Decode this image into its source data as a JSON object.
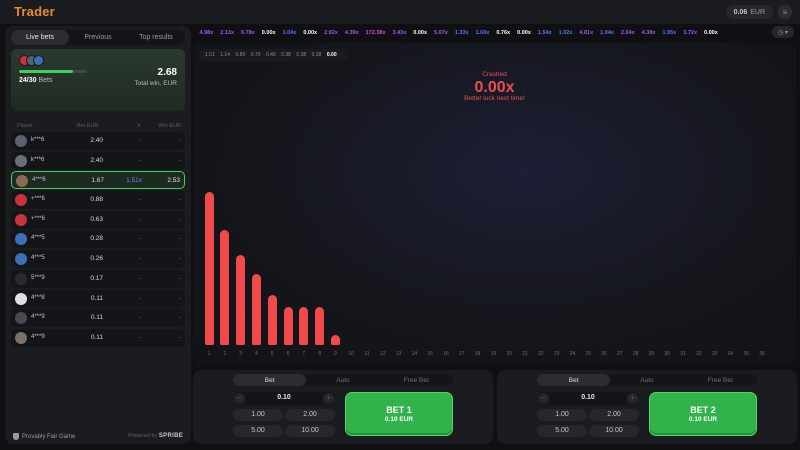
{
  "app": {
    "title": "Trader"
  },
  "header": {
    "balance_value": "0.06",
    "balance_currency": "EUR",
    "menu_icon": "hamburger-icon"
  },
  "left_panel": {
    "tabs": [
      "Live bets",
      "Previous",
      "Top results"
    ],
    "active_tab": 0,
    "summary": {
      "bets_count": "24/30",
      "bets_label": "Bets",
      "total_win": "2.68",
      "total_win_label": "Total win, EUR",
      "progress": 0.8
    },
    "columns": {
      "player": "Player",
      "bet": "Bet EUR",
      "x": "X",
      "win": "Win EUR"
    },
    "players": [
      {
        "name": "k***6",
        "bet": "2.40",
        "x": "-",
        "win": "-",
        "avatar_color": "#5a6270",
        "highlighted": false
      },
      {
        "name": "k***6",
        "bet": "2.40",
        "x": "-",
        "win": "-",
        "avatar_color": "#6b6f78",
        "highlighted": false
      },
      {
        "name": "4***6",
        "bet": "1.67",
        "x": "1.51x",
        "win": "2.53",
        "avatar_color": "#8a6a55",
        "highlighted": true
      },
      {
        "name": "+***6",
        "bet": "0.88",
        "x": "-",
        "win": "-",
        "avatar_color": "#c8323c",
        "highlighted": false
      },
      {
        "name": "+***6",
        "bet": "0.63",
        "x": "-",
        "win": "-",
        "avatar_color": "#c8323c",
        "highlighted": false
      },
      {
        "name": "4***5",
        "bet": "0.28",
        "x": "-",
        "win": "-",
        "avatar_color": "#3b6fb6",
        "highlighted": false
      },
      {
        "name": "4***5",
        "bet": "0.26",
        "x": "-",
        "win": "-",
        "avatar_color": "#3b6fb6",
        "highlighted": false
      },
      {
        "name": "5***9",
        "bet": "0.17",
        "x": "-",
        "win": "-",
        "avatar_color": "#2a2b30",
        "highlighted": false
      },
      {
        "name": "4***8",
        "bet": "0.11",
        "x": "-",
        "win": "-",
        "avatar_color": "#e0e0e4",
        "highlighted": false
      },
      {
        "name": "4***9",
        "bet": "0.11",
        "x": "-",
        "win": "-",
        "avatar_color": "#4a4b52",
        "highlighted": false
      },
      {
        "name": "4***9",
        "bet": "0.11",
        "x": "-",
        "win": "-",
        "avatar_color": "#7a7066",
        "highlighted": false
      }
    ],
    "footer": {
      "provably_fair": "Provably Fair Game",
      "powered_by": "Powered by",
      "brand": "SPRIBE"
    }
  },
  "history": [
    {
      "v": "4.98x",
      "c": "#a855f7"
    },
    {
      "v": "2.13x",
      "c": "#a855f7"
    },
    {
      "v": "6.78x",
      "c": "#a855f7"
    },
    {
      "v": "0.00x",
      "c": "#ffffff"
    },
    {
      "v": "1.04x",
      "c": "#4f7cff"
    },
    {
      "v": "0.00x",
      "c": "#ffffff"
    },
    {
      "v": "2.92x",
      "c": "#a855f7"
    },
    {
      "v": "4.39x",
      "c": "#a855f7"
    },
    {
      "v": "172.38x",
      "c": "#d946ef"
    },
    {
      "v": "3.43x",
      "c": "#a855f7"
    },
    {
      "v": "0.00x",
      "c": "#ffffff"
    },
    {
      "v": "5.07x",
      "c": "#a855f7"
    },
    {
      "v": "1.33x",
      "c": "#4f7cff"
    },
    {
      "v": "1.60x",
      "c": "#4f7cff"
    },
    {
      "v": "0.76x",
      "c": "#ffffff"
    },
    {
      "v": "0.00x",
      "c": "#ffffff"
    },
    {
      "v": "1.54x",
      "c": "#4f7cff"
    },
    {
      "v": "1.02x",
      "c": "#4f7cff"
    },
    {
      "v": "4.81x",
      "c": "#a855f7"
    },
    {
      "v": "1.04x",
      "c": "#4f7cff"
    },
    {
      "v": "2.04x",
      "c": "#a855f7"
    },
    {
      "v": "4.38x",
      "c": "#a855f7"
    },
    {
      "v": "1.95x",
      "c": "#4f7cff"
    },
    {
      "v": "3.72x",
      "c": "#a855f7"
    },
    {
      "v": "0.00x",
      "c": "#ffffff"
    }
  ],
  "history_icon": "history-clock-icon",
  "game": {
    "recent_values": [
      "1.51",
      "1.14",
      "0.89",
      "0.70",
      "0.49",
      "0.38",
      "0.38",
      "0.38",
      "0.00"
    ],
    "status": "Crashed",
    "multiplier": "0.00x",
    "message": "Better luck next time!"
  },
  "chart_data": {
    "type": "bar",
    "categories": [
      "1",
      "2",
      "3",
      "4",
      "5",
      "6",
      "7",
      "8",
      "9",
      "10",
      "11",
      "12",
      "13",
      "14",
      "15",
      "16",
      "17",
      "18",
      "19",
      "20",
      "21",
      "22",
      "23",
      "24",
      "25",
      "26",
      "27",
      "28",
      "29",
      "30",
      "31",
      "32",
      "33",
      "34",
      "35",
      "36"
    ],
    "values": [
      1.51,
      1.14,
      0.89,
      0.7,
      0.49,
      0.38,
      0.38,
      0.38,
      0.0
    ],
    "ylim": [
      0,
      1.6
    ],
    "color": "#f24a4a",
    "grid": false
  },
  "bet_panels": [
    {
      "tabs": [
        "Bet",
        "Auto",
        "Free Bet"
      ],
      "active_tab": 0,
      "stake": "0.10",
      "quick": [
        "1.00",
        "2.00",
        "5.00",
        "10.00"
      ],
      "button_label": "BET 1",
      "button_amount": "0.10 EUR"
    },
    {
      "tabs": [
        "Bet",
        "Auto",
        "Free Bet"
      ],
      "active_tab": 0,
      "stake": "0.10",
      "quick": [
        "1.00",
        "2.00",
        "5.00",
        "10.00"
      ],
      "button_label": "BET 2",
      "button_amount": "0.10 EUR"
    }
  ]
}
